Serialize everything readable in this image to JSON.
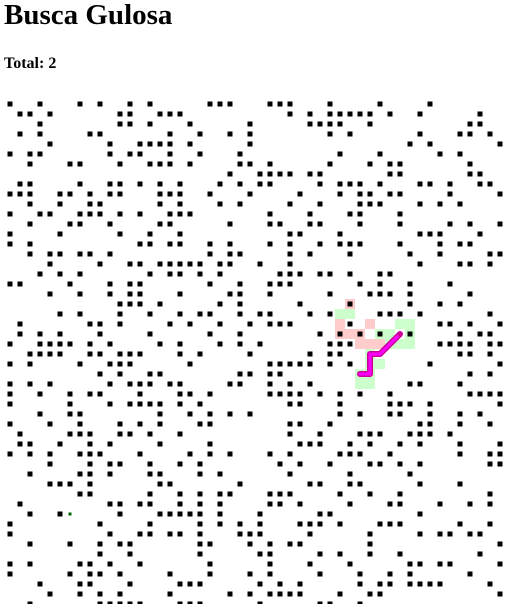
{
  "title": "Busca Gulosa",
  "total_label": "Total:",
  "total_value": "2",
  "colors": {
    "background": "#ffffff",
    "wall": "#000000",
    "visited": "#ffcccc",
    "frontier": "#ccffcc",
    "path": "#ff00ff",
    "path_shadow": "#cc0099",
    "start": "#006600"
  },
  "grid": {
    "columns": 50,
    "rows": 51,
    "visited_cells": [
      [
        33,
        21
      ],
      [
        33,
        22
      ],
      [
        33,
        23
      ],
      [
        34,
        23
      ],
      [
        35,
        23
      ],
      [
        35,
        24
      ],
      [
        36,
        24
      ],
      [
        37,
        24
      ],
      [
        36,
        22
      ],
      [
        34,
        20
      ]
    ],
    "frontier_cells": [
      [
        39,
        22
      ],
      [
        40,
        22
      ],
      [
        40,
        23
      ],
      [
        40,
        24
      ],
      [
        39,
        24
      ],
      [
        38,
        23
      ],
      [
        37,
        23
      ],
      [
        36,
        25
      ],
      [
        36,
        26
      ],
      [
        37,
        26
      ],
      [
        36,
        27
      ],
      [
        35,
        27
      ],
      [
        35,
        28
      ],
      [
        36,
        28
      ],
      [
        38,
        24
      ],
      [
        33,
        21
      ],
      [
        34,
        21
      ]
    ],
    "path_cells": [
      [
        39,
        23
      ],
      [
        38,
        24
      ],
      [
        37,
        25
      ],
      [
        36,
        25
      ],
      [
        36,
        26
      ],
      [
        36,
        27
      ],
      [
        35,
        27
      ]
    ],
    "start_cell": [
      6,
      41
    ],
    "goal_cell": [
      39,
      23
    ]
  }
}
